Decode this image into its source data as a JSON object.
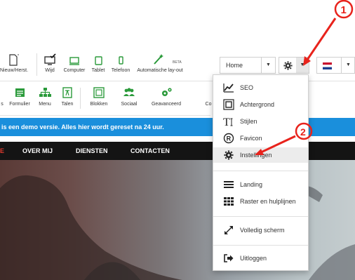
{
  "toolbar": {
    "undo_redo": "Nieuw/Herst.",
    "devices": [
      "Wijd",
      "Computer",
      "Tablet",
      "Telefoon",
      "Automatische lay-out"
    ],
    "beta": "BETA"
  },
  "page_select": {
    "value": "Home"
  },
  "toolbar2": {
    "items": [
      "Formulier",
      "Menu",
      "Talen",
      "Blokken",
      "Sociaal",
      "Geavanceerd",
      "Co"
    ]
  },
  "banner": {
    "text": "is een demo versie. Alles hier wordt gereset na 24 uur."
  },
  "nav": {
    "items": [
      "E",
      "OVER MIJ",
      "DIENSTEN",
      "CONTACTEN"
    ]
  },
  "menu": {
    "items": [
      {
        "label": "SEO",
        "icon": "chart-line-icon"
      },
      {
        "label": "Achtergrond",
        "icon": "background-icon"
      },
      {
        "label": "Stijlen",
        "icon": "text-style-icon"
      },
      {
        "label": "Favicon",
        "icon": "registered-icon"
      },
      {
        "label": "Instellingen",
        "icon": "gear-icon"
      },
      {
        "label": "Landing",
        "icon": "hamburger-icon"
      },
      {
        "label": "Raster en hulplijnen",
        "icon": "grid-icon"
      },
      {
        "label": "Volledig scherm",
        "icon": "expand-icon"
      },
      {
        "label": "Uitloggen",
        "icon": "logout-icon"
      }
    ]
  },
  "annotations": {
    "marker_1": "1",
    "marker_2": "2"
  },
  "colors": {
    "accent_blue": "#1a8fdc",
    "nav_bg": "#141414",
    "nav_active": "#e23a2e",
    "annotation_red": "#e8231c",
    "green_icons": "#2a9a3a"
  }
}
